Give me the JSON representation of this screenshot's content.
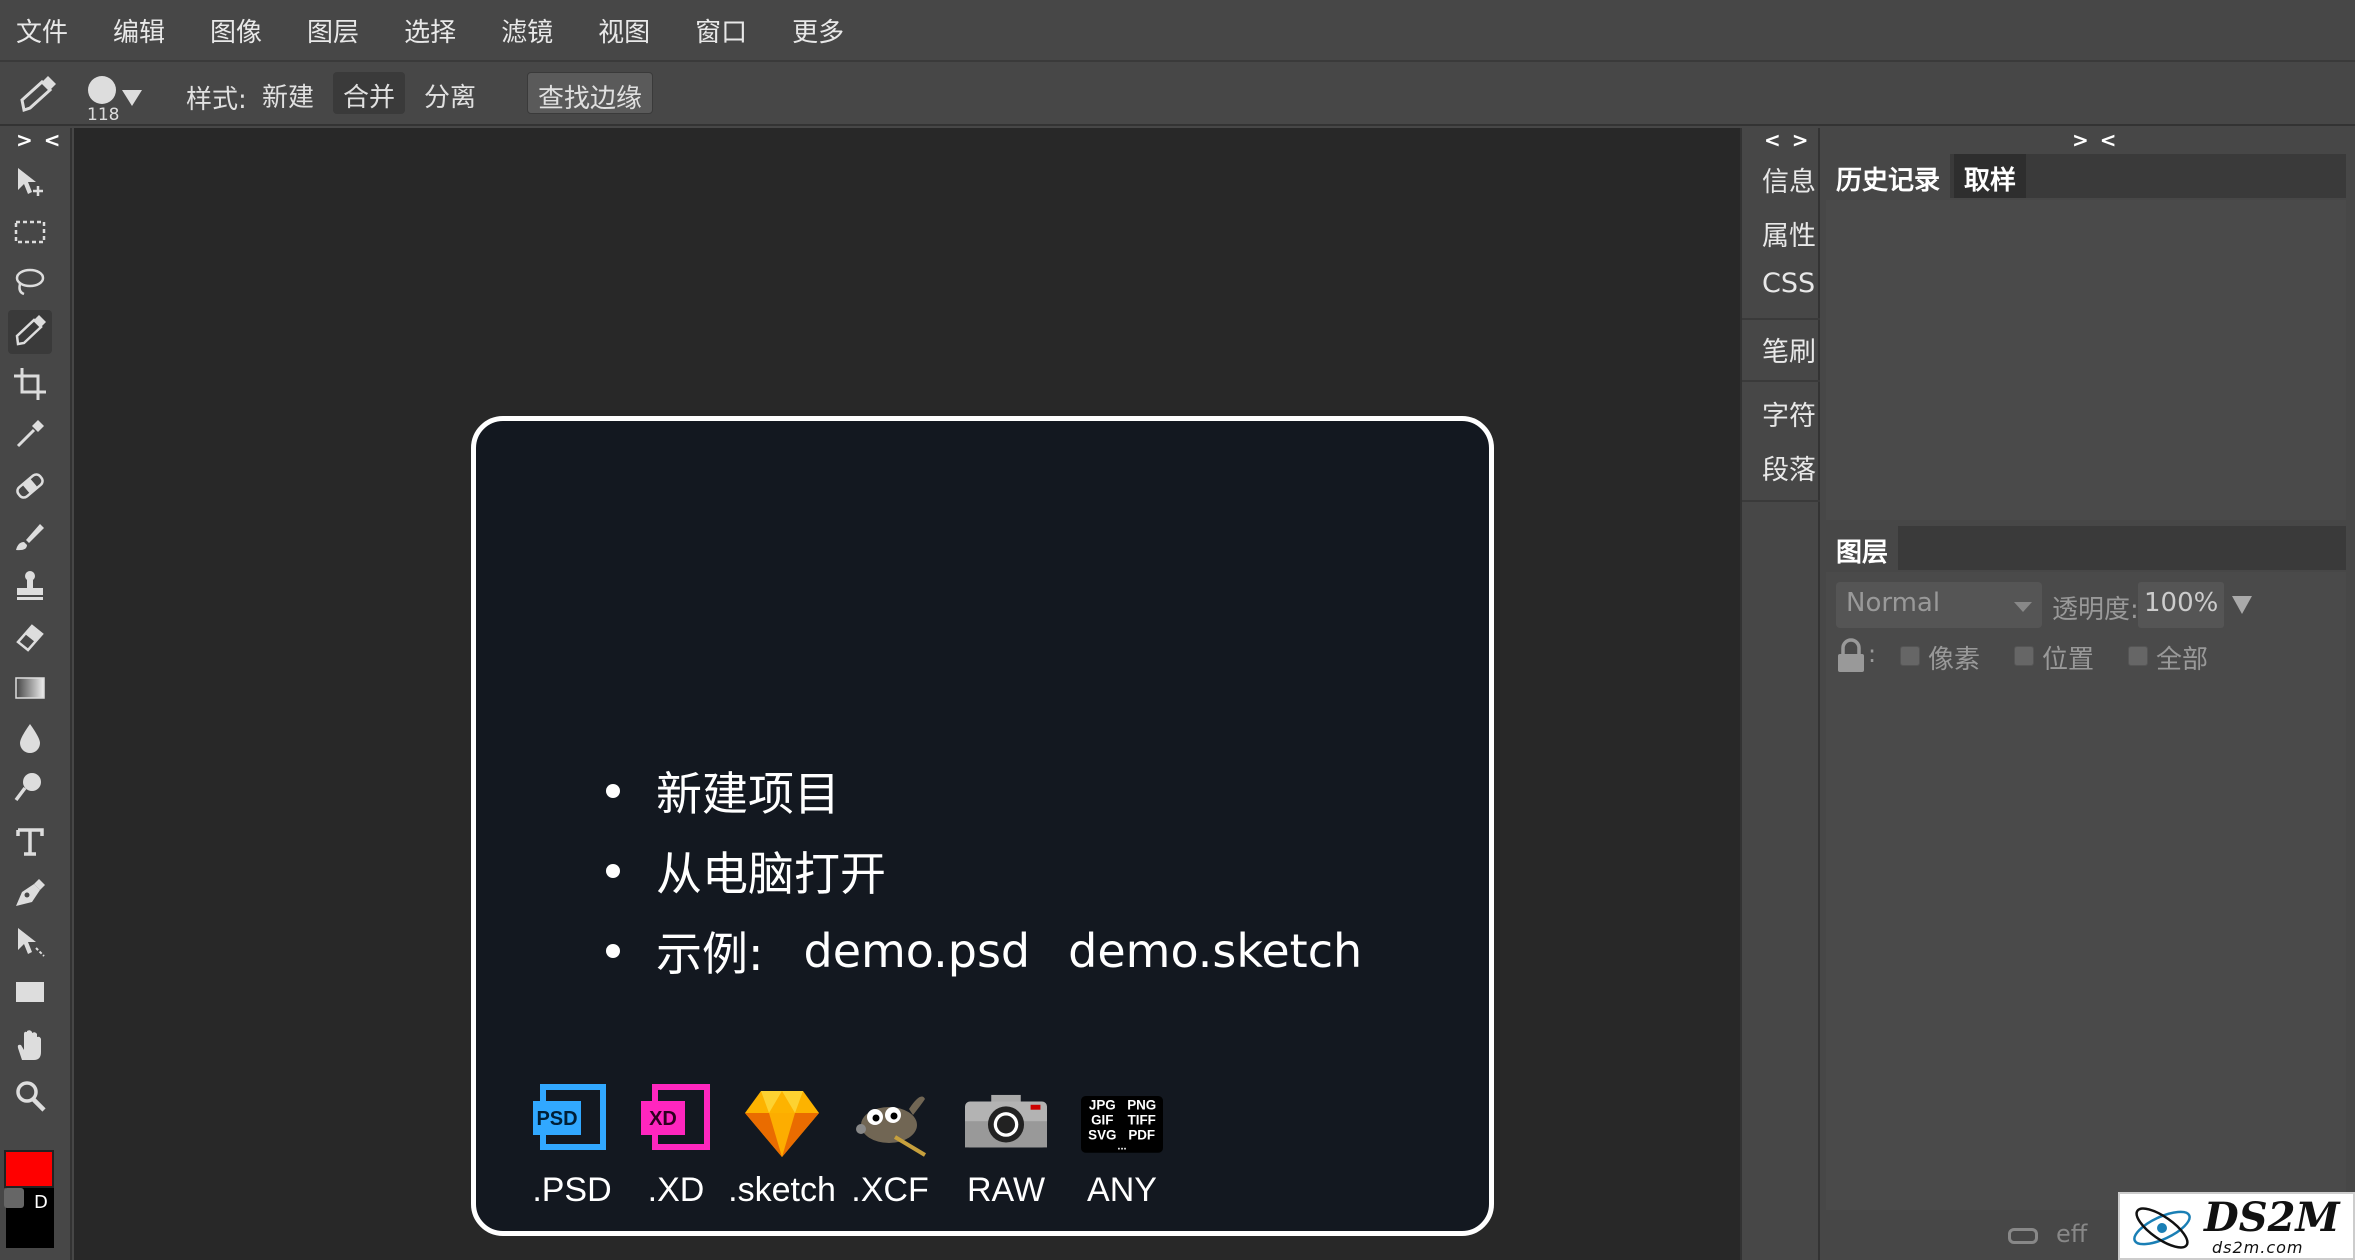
{
  "menu": [
    "文件",
    "编辑",
    "图像",
    "图层",
    "选择",
    "滤镜",
    "视图",
    "窗口",
    "更多"
  ],
  "options": {
    "brush_size": "118",
    "style_label": "样式:",
    "new_label": "新建",
    "merge_label": "合并",
    "separate_label": "分离",
    "find_edges_label": "查找边缘"
  },
  "toolbar": {
    "collapse_label": "> <",
    "tools": [
      "move-tool",
      "marquee-tool",
      "lasso-tool",
      "quick-select-tool",
      "crop-tool",
      "eyedropper-tool",
      "healing-tool",
      "brush-tool",
      "stamp-tool",
      "eraser-tool",
      "gradient-tool",
      "blur-tool",
      "dodge-tool",
      "text-tool",
      "pen-tool",
      "path-select-tool",
      "shape-tool",
      "hand-tool",
      "zoom-tool"
    ],
    "foreground_color": "#ff0000",
    "background_color": "#000000",
    "default_label": "D"
  },
  "start": {
    "items": [
      "新建项目",
      "从电脑打开",
      "示例:"
    ],
    "examples": [
      "demo.psd",
      "demo.sketch"
    ],
    "formats": [
      ".PSD",
      ".XD",
      ".sketch",
      ".XCF",
      "RAW",
      "ANY"
    ],
    "any_icon_text": [
      "JPG",
      "PNG",
      "GIF",
      "TIFF",
      "SVG",
      "PDF",
      "..."
    ],
    "psd_icon_text": "PSD",
    "xd_icon_text": "XD"
  },
  "side_panel": {
    "arrows": "< >",
    "items": [
      "信息",
      "属性",
      "CSS",
      "笔刷",
      "字符",
      "段落"
    ]
  },
  "right_panel": {
    "arrows": "> <",
    "history_tab": "历史记录",
    "swatches_tab": "取样",
    "layers_tab": "图层",
    "blend_mode": "Normal",
    "opacity_label": "透明度:",
    "opacity_value": "100%",
    "lock_colon": ":",
    "lock_pixels": "像素",
    "lock_position": "位置",
    "lock_all": "全部",
    "footer_eff": "eff"
  },
  "watermark": {
    "title": "DS2M",
    "subtitle": "ds2m.com"
  }
}
